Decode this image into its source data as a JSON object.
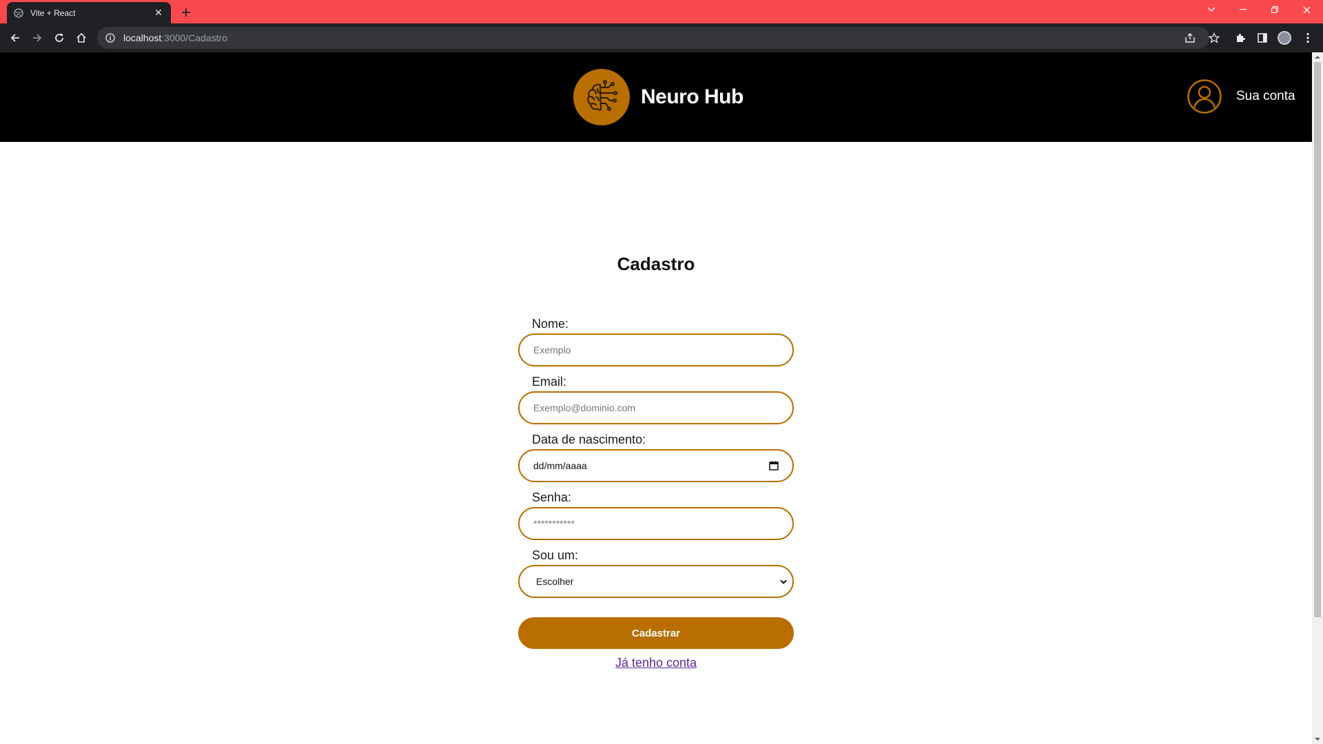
{
  "browser": {
    "tab_title": "Vite + React",
    "url_host": "localhost",
    "url_path": ":3000/Cadastro",
    "accent_color": "#f84a4d"
  },
  "header": {
    "brand_name": "Neuro Hub",
    "account_label": "Sua conta",
    "logo_color": "#b86f00",
    "logo_icon": "brain-circuit-icon"
  },
  "main": {
    "title": "Cadastro",
    "fields": [
      {
        "label": "Nome:",
        "placeholder": "Exemplo"
      },
      {
        "label": "Email:",
        "placeholder": "Exemplo@dominio.com"
      },
      {
        "label": "Data de nascimento:",
        "placeholder": "dd/mm/aaaa"
      },
      {
        "label": "Senha:",
        "placeholder": "***********"
      },
      {
        "label": "Sou um:",
        "selected": "Escolher"
      }
    ],
    "submit_label": "Cadastrar",
    "login_link": "Já tenho conta",
    "accent_color": "#b86f00"
  }
}
